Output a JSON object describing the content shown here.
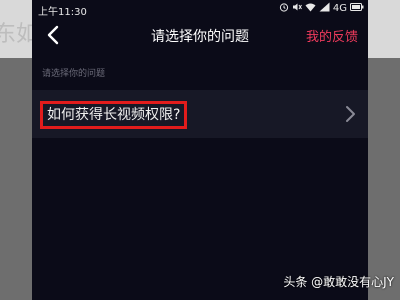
{
  "background": {
    "ghost_text": "东如"
  },
  "status_bar": {
    "time": "上午11:30",
    "network": "4G"
  },
  "nav": {
    "title": "请选择你的问题",
    "feedback_label": "我的反馈"
  },
  "section_label": "请选择你的问题",
  "questions": [
    {
      "label": "如何获得长视频权限?"
    }
  ],
  "watermark": "头条 @敢敢没有心JY",
  "colors": {
    "accent": "#f03b5c",
    "highlight_box": "#e21c1c",
    "screen_bg": "#0b0b18",
    "row_bg": "#171826"
  },
  "icons": [
    "back-arrow-icon",
    "chevron-right-icon",
    "alarm-icon",
    "wifi-icon",
    "signal-icon",
    "battery-icon"
  ]
}
